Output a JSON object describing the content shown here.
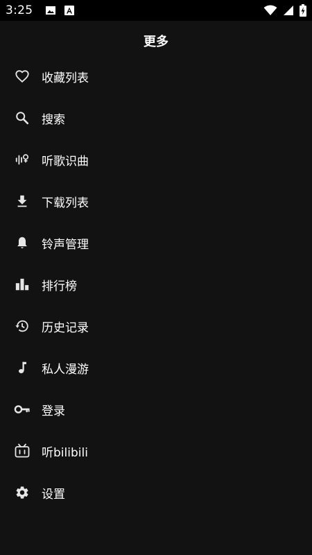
{
  "status_bar": {
    "time": "3:25",
    "left_icons": [
      "image-icon",
      "a-badge-icon"
    ],
    "right_icons": [
      "wifi-icon",
      "signal-icon",
      "battery-charging-icon"
    ]
  },
  "header": {
    "title": "更多"
  },
  "menu": {
    "items": [
      {
        "label": "收藏列表",
        "icon": "heart-icon"
      },
      {
        "label": "搜索",
        "icon": "search-icon"
      },
      {
        "label": "听歌识曲",
        "icon": "music-recognition-icon"
      },
      {
        "label": "下载列表",
        "icon": "download-icon"
      },
      {
        "label": "铃声管理",
        "icon": "bell-icon"
      },
      {
        "label": "排行榜",
        "icon": "bar-chart-icon"
      },
      {
        "label": "历史记录",
        "icon": "history-icon"
      },
      {
        "label": "私人漫游",
        "icon": "music-note-icon"
      },
      {
        "label": "登录",
        "icon": "key-icon"
      },
      {
        "label": "听bilibili",
        "icon": "bilibili-tv-icon"
      },
      {
        "label": "设置",
        "icon": "gear-icon"
      }
    ]
  },
  "colors": {
    "background": "#121212",
    "status_bar": "#000000",
    "text": "#ffffff",
    "icon": "#e6e6e6"
  }
}
